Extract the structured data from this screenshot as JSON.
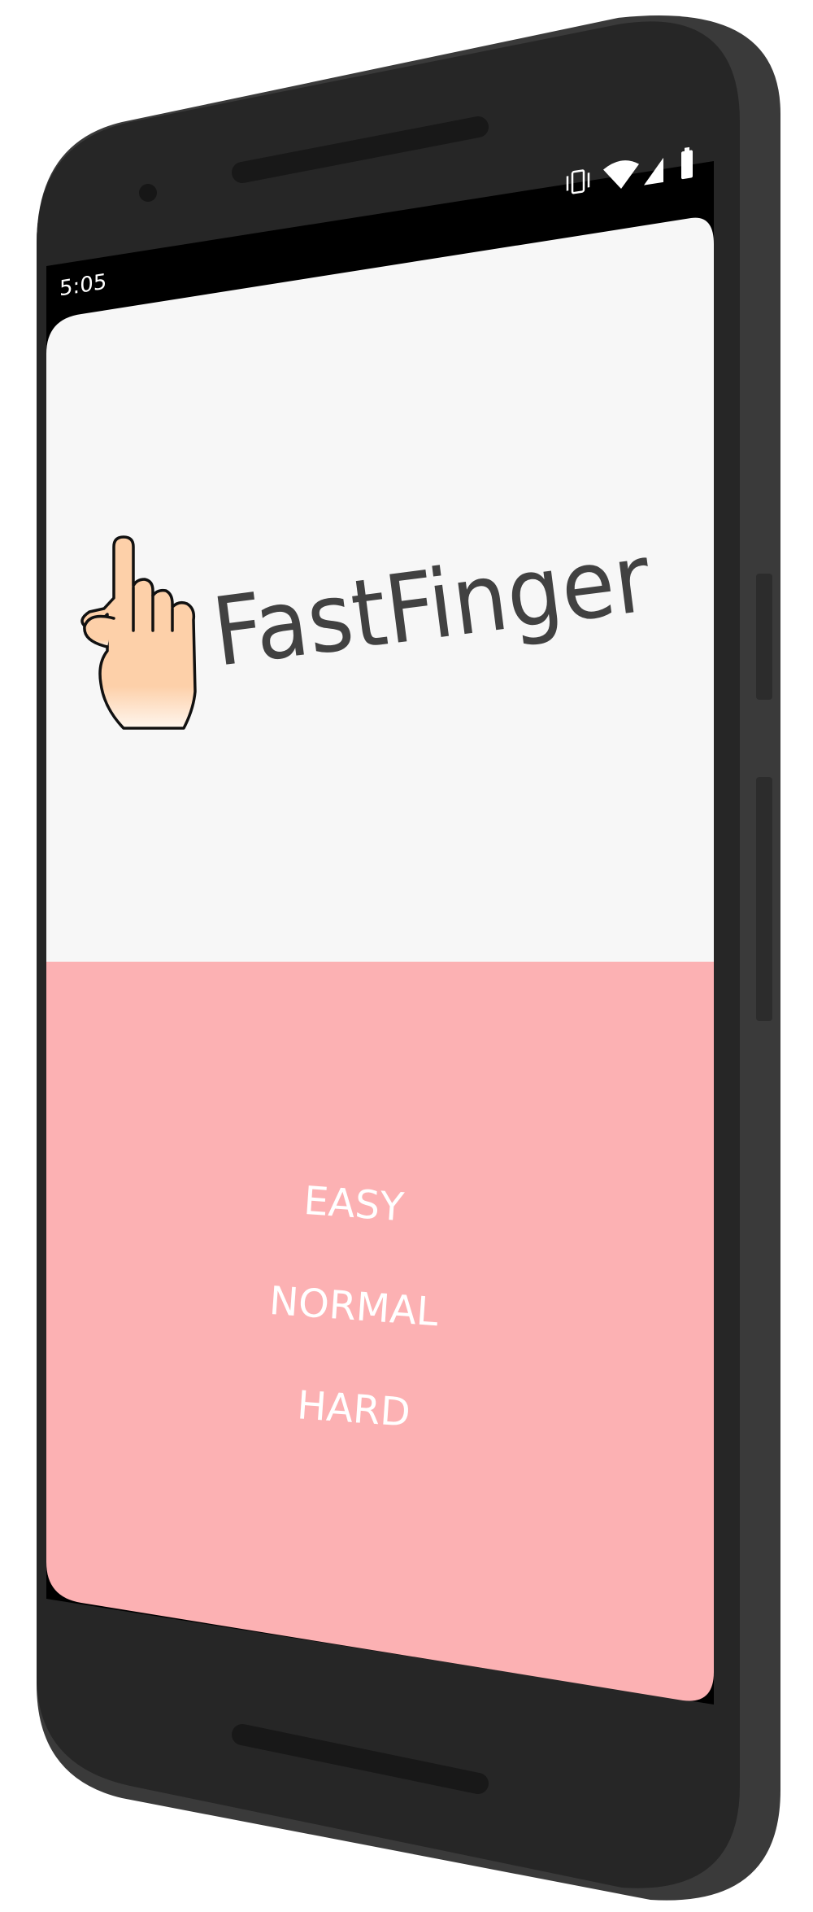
{
  "status_bar": {
    "time": "5:05",
    "icons": [
      "vibrate-icon",
      "wifi-icon",
      "signal-icon",
      "battery-icon"
    ]
  },
  "app": {
    "name": "FastFinger",
    "logo_icon": "pointing-hand-icon"
  },
  "difficulty_menu": {
    "easy": "EASY",
    "normal": "NORMAL",
    "hard": "HARD"
  },
  "colors": {
    "top_panel": "#f7f7f7",
    "bottom_panel": "#fcb1b3",
    "button_text": "#ffffff",
    "logo_text": "#414141",
    "device_body": "#262626",
    "hand_fill": "#fdd0a9"
  }
}
